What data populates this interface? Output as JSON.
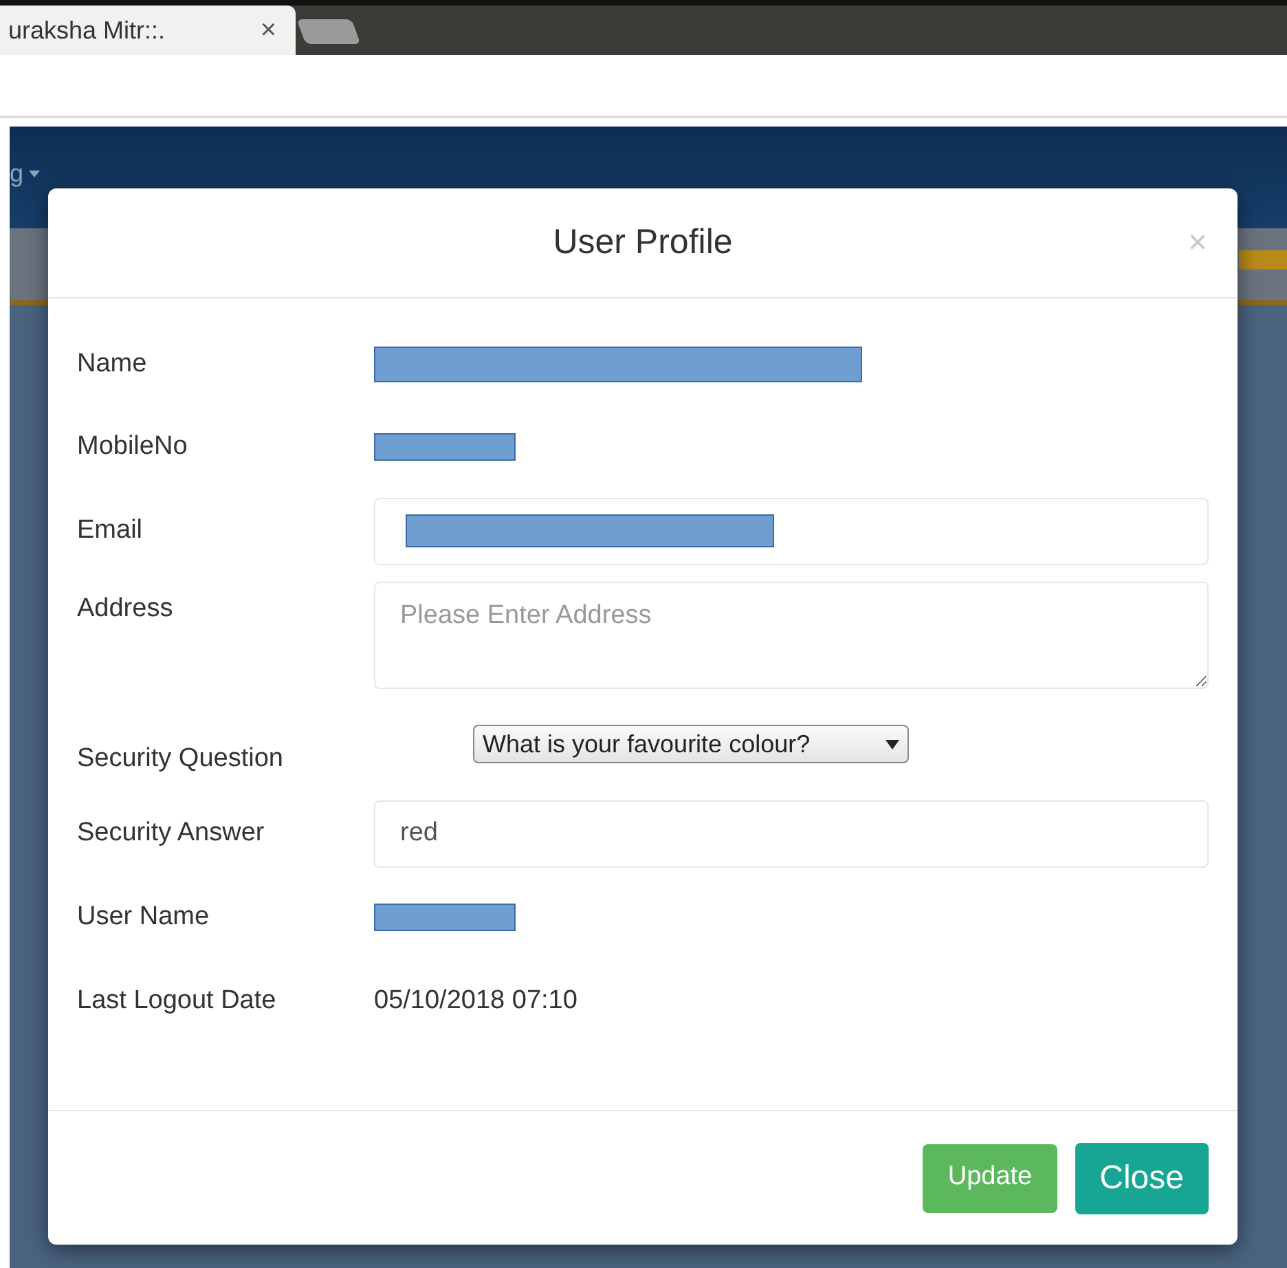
{
  "browser": {
    "tab": {
      "title": "uraksha Mitr::.",
      "close": "×"
    }
  },
  "nav": {
    "menu_label": "g"
  },
  "dialog": {
    "title": "User Profile",
    "close": "×",
    "fields": [
      {
        "kind": "redacted_wide",
        "label": "Name"
      },
      {
        "kind": "redacted",
        "label": "MobileNo"
      },
      {
        "kind": "input_redacted",
        "label": "Email"
      },
      {
        "kind": "textarea",
        "label": "Address",
        "placeholder": "Please Enter Address"
      },
      {
        "kind": "select",
        "label": "Security Question",
        "value": "What is your favourite colour?"
      },
      {
        "kind": "input",
        "label": "Security Answer",
        "value": "red"
      },
      {
        "kind": "redacted",
        "label": "User Name"
      },
      {
        "kind": "text",
        "label": "Last Logout Date",
        "value": "05/10/2018 07:10"
      }
    ],
    "buttons": [
      {
        "label": "Update",
        "kind": "success"
      },
      {
        "label": "Close",
        "kind": "primary"
      }
    ]
  }
}
